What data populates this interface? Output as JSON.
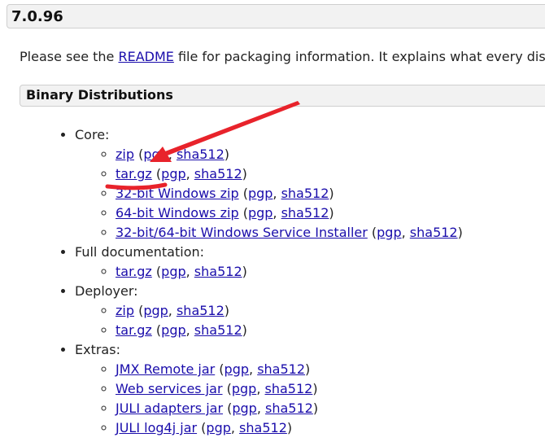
{
  "version": {
    "title": "7.0.96"
  },
  "intro": {
    "before": "Please see the ",
    "link": "README",
    "after": " file for packaging information. It explains what every dis"
  },
  "section": {
    "title": "Binary Distributions"
  },
  "groups": {
    "core": {
      "label": "Core:",
      "items": [
        {
          "main": "zip",
          "pgp": "pgp",
          "sha": "sha512"
        },
        {
          "main": "tar.gz",
          "pgp": "pgp",
          "sha": "sha512"
        },
        {
          "main": "32-bit Windows zip",
          "pgp": "pgp",
          "sha": "sha512"
        },
        {
          "main": "64-bit Windows zip",
          "pgp": "pgp",
          "sha": "sha512"
        },
        {
          "main": "32-bit/64-bit Windows Service Installer",
          "pgp": "pgp",
          "sha": "sha512"
        }
      ]
    },
    "fulldoc": {
      "label": "Full documentation:",
      "items": [
        {
          "main": "tar.gz",
          "pgp": "pgp",
          "sha": "sha512"
        }
      ]
    },
    "deployer": {
      "label": "Deployer:",
      "items": [
        {
          "main": "zip",
          "pgp": "pgp",
          "sha": "sha512"
        },
        {
          "main": "tar.gz",
          "pgp": "pgp",
          "sha": "sha512"
        }
      ]
    },
    "extras": {
      "label": "Extras:",
      "items": [
        {
          "main": "JMX Remote jar",
          "pgp": "pgp",
          "sha": "sha512"
        },
        {
          "main": "Web services jar",
          "pgp": "pgp",
          "sha": "sha512"
        },
        {
          "main": "JULI adapters jar",
          "pgp": "pgp",
          "sha": "sha512"
        },
        {
          "main": "JULI log4j jar",
          "pgp": "pgp",
          "sha": "sha512"
        }
      ]
    }
  },
  "annotation": {
    "color": "#e8232b"
  }
}
